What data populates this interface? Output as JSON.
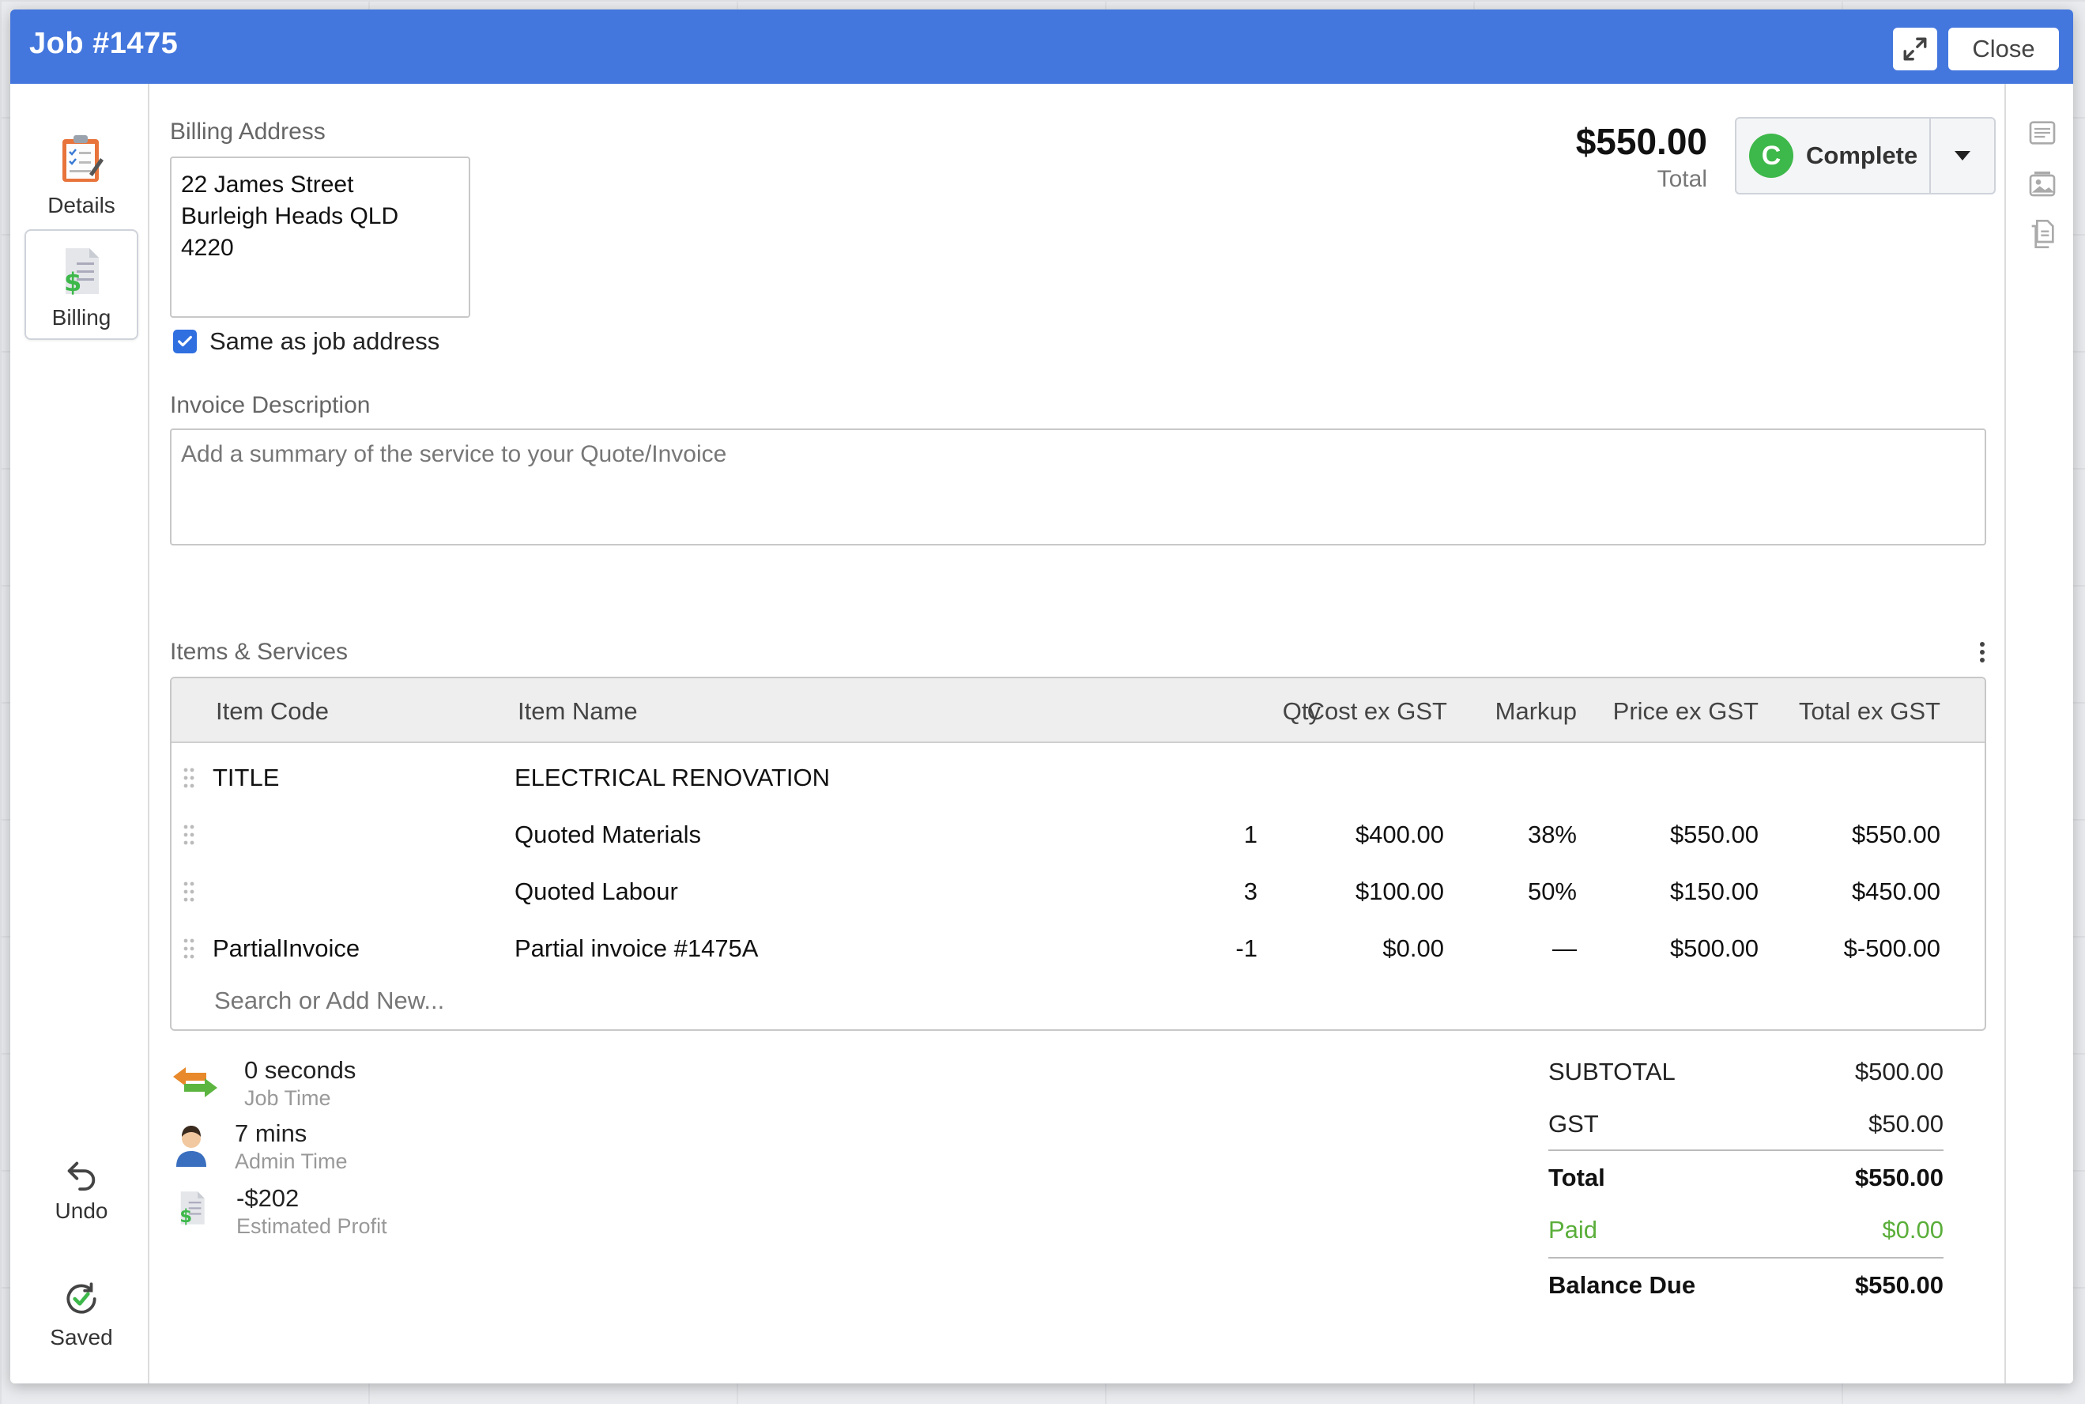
{
  "header": {
    "title": "Job #1475",
    "expand_icon": "expand-icon",
    "close_label": "Close"
  },
  "sidebar": {
    "items": [
      {
        "label": "Details",
        "icon": "clipboard-icon"
      },
      {
        "label": "Billing",
        "icon": "invoice-dollar-icon"
      }
    ],
    "undo_label": "Undo",
    "saved_label": "Saved"
  },
  "billing": {
    "address_label": "Billing Address",
    "address_value": "22 James Street\nBurleigh Heads QLD\n4220",
    "same_as_job_label": "Same as job address",
    "same_as_job_checked": true,
    "invoice_description_label": "Invoice Description",
    "invoice_description_placeholder": "Add a summary of the service to your Quote/Invoice"
  },
  "total": {
    "amount": "$550.00",
    "caption": "Total"
  },
  "status": {
    "letter": "C",
    "label": "Complete",
    "color": "#3db84a"
  },
  "items_section": {
    "label": "Items & Services",
    "columns": [
      "Item Code",
      "Item Name",
      "Qty",
      "Cost ex GST",
      "Markup",
      "Price ex GST",
      "Total ex GST"
    ],
    "rows": [
      {
        "code": "TITLE",
        "name": "ELECTRICAL RENOVATION",
        "qty": "",
        "cost": "",
        "markup": "",
        "price": "",
        "total": ""
      },
      {
        "code": "",
        "name": "Quoted Materials",
        "qty": "1",
        "cost": "$400.00",
        "markup": "38%",
        "price": "$550.00",
        "total": "$550.00"
      },
      {
        "code": "",
        "name": "Quoted Labour",
        "qty": "3",
        "cost": "$100.00",
        "markup": "50%",
        "price": "$150.00",
        "total": "$450.00"
      },
      {
        "code": "PartialInvoice",
        "name": "Partial invoice #1475A",
        "qty": "-1",
        "cost": "$0.00",
        "markup": "—",
        "price": "$500.00",
        "total": "$-500.00"
      }
    ],
    "search_placeholder": "Search or Add New..."
  },
  "stats": {
    "job_time_value": "0 seconds",
    "job_time_caption": "Job Time",
    "admin_time_value": "7 mins",
    "admin_time_caption": "Admin Time",
    "profit_value": "-$202",
    "profit_caption": "Estimated Profit"
  },
  "summary": {
    "subtotal_label": "SUBTOTAL",
    "subtotal_value": "$500.00",
    "gst_label": "GST",
    "gst_value": "$50.00",
    "total_label": "Total",
    "total_value": "$550.00",
    "paid_label": "Paid",
    "paid_value": "$0.00",
    "balance_label": "Balance Due",
    "balance_value": "$550.00"
  },
  "colors": {
    "header_bg": "#4477dd",
    "checkbox": "#2f6fe0",
    "paid_green": "#5aae3a"
  }
}
